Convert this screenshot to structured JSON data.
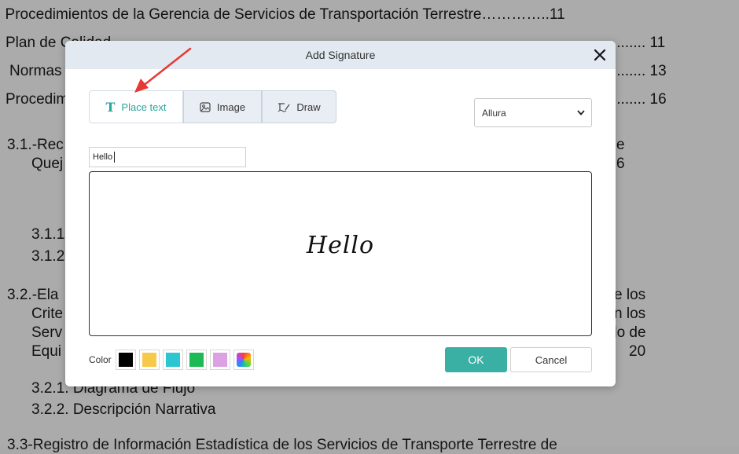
{
  "document": {
    "lines": [
      {
        "text": ". Procedimientos de la Gerencia de Servicios de Transportación Terrestre…………..11"
      },
      {
        "text": "Plan de Calidad"
      },
      {
        "text": "........ 11"
      },
      {
        "text": "Normas"
      },
      {
        "text": "........ 13"
      },
      {
        "text": "Procedim"
      },
      {
        "text": "........ 16"
      },
      {
        "text": "3.1.-Rec"
      },
      {
        "text": "e"
      },
      {
        "text": "Quej"
      },
      {
        "text": "6"
      },
      {
        "text": "3.1.1"
      },
      {
        "text": "3.1.2"
      },
      {
        "text": "3.2.-Ela"
      },
      {
        "text": "e  los"
      },
      {
        "text": "Crite"
      },
      {
        "text": "n  los"
      },
      {
        "text": "Serv"
      },
      {
        "text": "do  de"
      },
      {
        "text": "Equi"
      },
      {
        "text": "20"
      },
      {
        "text": "3.2.1. Diagrama de Flujo"
      },
      {
        "text": "3.2.2. Descripción Narrativa"
      },
      {
        "text": "3.3-Registro de Información Estadística de los Servicios de Transporte Terrestre de"
      }
    ]
  },
  "modal": {
    "title": "Add Signature",
    "tabs": [
      {
        "label": "Place text",
        "icon": "text-t-icon",
        "active": true
      },
      {
        "label": "Image",
        "icon": "image-icon",
        "active": false
      },
      {
        "label": "Draw",
        "icon": "draw-pen-icon",
        "active": false
      }
    ],
    "font_select": {
      "value": "Allura"
    },
    "text_input": {
      "value": "Hello"
    },
    "signature_preview": "Hello",
    "color": {
      "label": "Color",
      "swatches": [
        {
          "name": "black",
          "hex": "#000000"
        },
        {
          "name": "yellow",
          "hex": "#f7c948"
        },
        {
          "name": "cyan",
          "hex": "#2bc6cf"
        },
        {
          "name": "green",
          "hex": "#1db954"
        },
        {
          "name": "lavender",
          "hex": "#dca1e3"
        },
        {
          "name": "custom",
          "hex": "rainbow"
        }
      ]
    },
    "ok_label": "OK",
    "cancel_label": "Cancel"
  },
  "colors": {
    "accent": "#3ab0a5",
    "header": "#e2e9f1",
    "arrow": "#e53935"
  }
}
